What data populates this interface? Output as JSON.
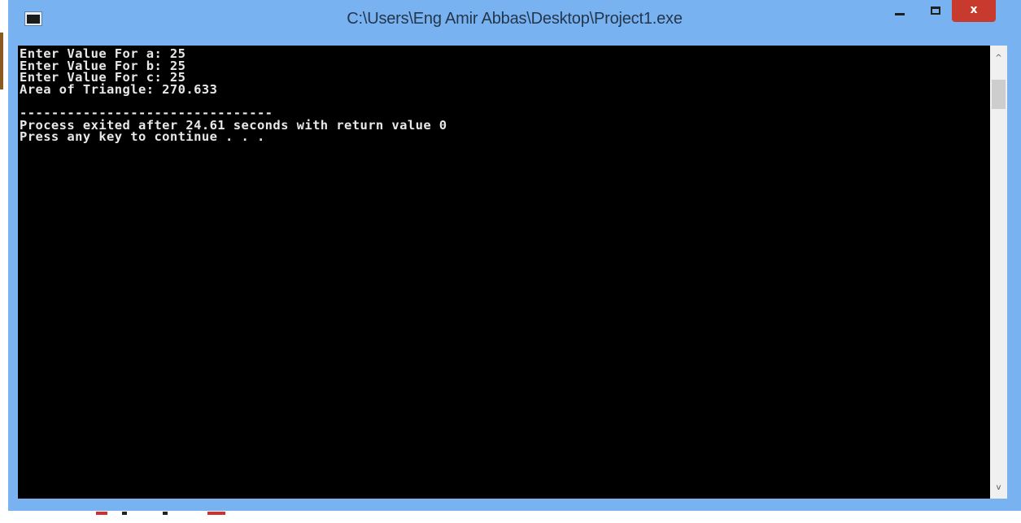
{
  "window": {
    "title": "C:\\Users\\Eng Amir Abbas\\Desktop\\Project1.exe",
    "controls": {
      "minimize_icon": "minimize-icon",
      "maximize_icon": "maximize-icon",
      "close_label": "x"
    },
    "colors": {
      "titlebar": "#78b2f0",
      "close_button": "#c93a2e",
      "console_background": "#000000",
      "console_text": "#e8e8e8"
    }
  },
  "console": {
    "lines": [
      "Enter Value For a: 25",
      "Enter Value For b: 25",
      "Enter Value For c: 25",
      "Area of Triangle: 270.633",
      "",
      "--------------------------------",
      "Process exited after 24.61 seconds with return value 0",
      "Press any key to continue . . ."
    ]
  },
  "scrollbar": {
    "up_arrow": "^",
    "down_arrow": "v"
  }
}
